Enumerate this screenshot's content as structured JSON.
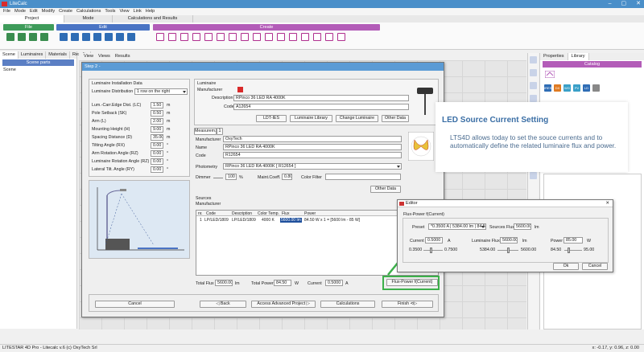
{
  "app": {
    "title": "LiteCalc",
    "window_buttons": [
      "–",
      "▢",
      "✕"
    ]
  },
  "menu": [
    "File",
    "Mode",
    "Edit",
    "Modify",
    "Create",
    "Calculations",
    "Tools",
    "View",
    "Link",
    "Help"
  ],
  "tabs": [
    "Project",
    "Mode",
    "Calculations and Results"
  ],
  "ribbon": {
    "file": "File",
    "edit": "Edit",
    "create": "Create"
  },
  "left_panel": {
    "tabs": [
      "Scene",
      "Luminaires",
      "Materials",
      "Results"
    ],
    "header": "Scene parts",
    "item": "Scene"
  },
  "view_menu": [
    "View",
    "Views",
    "Results"
  ],
  "right_panel": {
    "tabs": [
      "Properties",
      "Library"
    ],
    "header": "Catalog",
    "icons": [
      "IRES",
      "DX",
      "WG",
      "PV",
      "LD"
    ]
  },
  "status": {
    "left": "LITESTAR 4D Pro - Litecalc v.6    (c) OxyTech Srl",
    "right": "x: -0.17, y: 0.96, z: 0.00"
  },
  "step": {
    "title": "Step 2 -",
    "install": {
      "header": "Luminaire Installation Data",
      "distribution_label": "Luminaire Distribution",
      "distribution_value": "1 row on the right",
      "fields": [
        {
          "label": "Lum.-Carr.Edge Dist. (LC)",
          "value": "1.50",
          "unit": "m"
        },
        {
          "label": "Pole Setback (SK)",
          "value": "0.50",
          "unit": "m"
        },
        {
          "label": "Arm (L)",
          "value": "2.00",
          "unit": "m"
        },
        {
          "label": "Mounting Height (H)",
          "value": "9.00",
          "unit": "m"
        },
        {
          "label": "Spacing Distance (D)",
          "value": "35.00",
          "unit": "m"
        },
        {
          "label": "Tilting Angle (RX)",
          "value": "0.00",
          "unit": "°"
        },
        {
          "label": "Arm Rotation Angle (RZ)",
          "value": "0.00",
          "unit": "°"
        },
        {
          "label": "Luminaire Rotation Angle (RZ)",
          "value": "0.00",
          "unit": "°"
        },
        {
          "label": "Lateral Tilt. Angle (RY)",
          "value": "0.00",
          "unit": "°"
        }
      ]
    },
    "luminaire": {
      "header": "Luminaire",
      "manufacturer_label": "Manufacturer",
      "description_label": "Description",
      "description_value": "RPinco 36 LED RA 4000K",
      "code_label": "Code",
      "code_value": "A12654",
      "buttons": [
        "LDT-IES",
        "Luminaire Library",
        "Change Luminaire",
        "Other Data"
      ]
    },
    "measure": {
      "tab_label": "Measurem.",
      "tab_num": "1",
      "manufacturer_label": "Manufacturer",
      "manufacturer_value": "OxyTech",
      "name_label": "Name",
      "name_value": "RPinco 36 LED RA 4000K",
      "code_label": "Code",
      "code_value": "R12654",
      "photometry_label": "Photometry",
      "photometry_value": "RPinco 36 LED RA 4000K [ R12654 ]",
      "dimmer_label": "Dimmer",
      "dimmer_value": "100",
      "dimmer_unit": "%",
      "maint_label": "Maint.Coeff.",
      "maint_value": "0.80",
      "color_filter_label": "Color Filter",
      "other_data": "Other Data"
    },
    "sources": {
      "header": "Sources",
      "manufacturer_label": "Manufacturer",
      "columns": [
        "nr.",
        "Code",
        "Description",
        "Color Temp.",
        "Flux",
        "Power"
      ],
      "row": [
        "1",
        "LP/LED/1809",
        "LP/LED/1809",
        "4000 K",
        "5600.00 lm",
        "84.50 W   x 1 = [5600 lm - 85 W]"
      ]
    },
    "totals": {
      "flux_label": "Total Flux",
      "flux_value": "5600.00",
      "flux_unit": "lm",
      "power_label": "Total Power",
      "power_value": "84.50",
      "power_unit": "W",
      "current_label": "Current",
      "current_value": "0.5000",
      "current_unit": "A",
      "flux_power_button": "Flux-Power f(Current)"
    },
    "footer": [
      "Cancel",
      "◁  Back",
      "Access Advanced Project ▷",
      "Calculations",
      "Finish ⊲▷"
    ]
  },
  "editor": {
    "title": "Editor",
    "group": "Flux-Power f(Current)",
    "preset_label": "Preset",
    "preset_value": "*0.3500 A | 5384.00 lm | 84.50 W",
    "sources_flux_label": "Sources Flux",
    "sources_flux_value": "5600.00",
    "sources_flux_unit": "lm",
    "current_label": "Current",
    "current_value": "0.5000",
    "current_unit": "A",
    "current_min": "0.3500",
    "current_max": "0.7500",
    "lum_flux_label": "Luminaire Flux",
    "lum_flux_value": "5600.00",
    "lum_flux_unit": "lm",
    "lum_flux_min": "5384.00",
    "lum_flux_max": "5600.00",
    "power_label": "Power",
    "power_value": "85.00",
    "power_unit": "W",
    "power_min": "84.50",
    "power_max": "95.00",
    "ok": "Ok",
    "cancel": "Cancel"
  },
  "callout": {
    "title": "LED Source Current Setting",
    "body": "LTS4D allows today to set the souce currents and to automatically define the related luminaire flux and power."
  }
}
